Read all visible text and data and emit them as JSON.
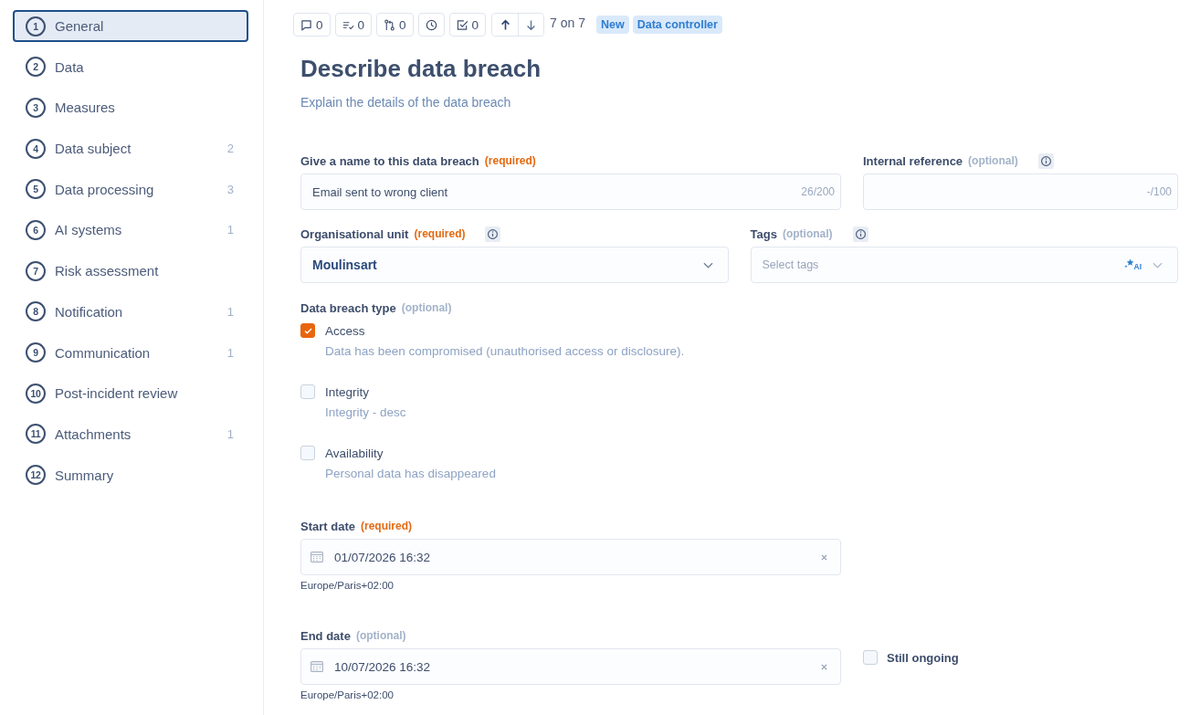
{
  "sidebar": {
    "items": [
      {
        "number": "1",
        "label": "General",
        "selected": true
      },
      {
        "number": "2",
        "label": "Data",
        "selected": false
      },
      {
        "number": "3",
        "label": "Measures",
        "selected": false
      },
      {
        "number": "4",
        "label": "Data subject",
        "count": "2",
        "selected": false
      },
      {
        "number": "5",
        "label": "Data processing",
        "count": "3",
        "selected": false
      },
      {
        "number": "6",
        "label": "AI systems",
        "count": "1",
        "selected": false
      },
      {
        "number": "7",
        "label": "Risk assessment",
        "selected": false
      },
      {
        "number": "8",
        "label": "Notification",
        "count": "1",
        "selected": false
      },
      {
        "number": "9",
        "label": "Communication",
        "count": "1",
        "selected": false
      },
      {
        "number": "10",
        "label": "Post-incident review",
        "selected": false
      },
      {
        "number": "11",
        "label": "Attachments",
        "count": "1",
        "selected": false
      },
      {
        "number": "12",
        "label": "Summary",
        "selected": false
      }
    ]
  },
  "toolbar": {
    "buttons": [
      {
        "kind": "comments",
        "count": "0"
      },
      {
        "kind": "tasks",
        "count": "0"
      },
      {
        "kind": "changes",
        "count": "0"
      },
      {
        "kind": "history"
      },
      {
        "kind": "checks",
        "count": "0"
      }
    ],
    "navigation": [
      {
        "kind": "up"
      },
      {
        "kind": "down"
      }
    ],
    "position": "7 on 7",
    "badges": [
      {
        "label": "New"
      },
      {
        "label": "Data controller"
      }
    ]
  },
  "header": {
    "title": "Describe data breach",
    "subtitle": "Explain the details of the data breach"
  },
  "form": {
    "rows": [
      [
        {
          "kind": "text",
          "label": "Give a name to this data breach",
          "tag": "(required)",
          "required": true,
          "value": "Email sent to wrong client",
          "counter": "26/200"
        },
        {
          "kind": "text",
          "label": "Internal reference",
          "tag": "(optional)",
          "required": false,
          "info": true,
          "counter": "-/100"
        }
      ],
      [
        {
          "kind": "select",
          "label": "Organisational unit",
          "tag": "(required)",
          "required": true,
          "info": true,
          "value": "Moulinsart"
        },
        {
          "kind": "tags",
          "label": "Tags",
          "tag": "(optional)",
          "required": false,
          "info": true,
          "placeholder": "Select tags",
          "ai_label": "AI"
        }
      ]
    ],
    "breach_type": {
      "label": "Data breach type",
      "tag": "(optional)",
      "required": false,
      "options": [
        {
          "label": "Access",
          "description": "Data has been compromised (unauthorised access or disclosure).",
          "checked": true
        },
        {
          "label": "Integrity",
          "description": "Integrity - desc",
          "checked": false
        },
        {
          "label": "Availability",
          "description": "Personal data has disappeared",
          "checked": false
        }
      ]
    },
    "start_date": {
      "label": "Start date",
      "tag": "(required)",
      "required": true,
      "value": "01/07/2026 16:32",
      "timezone": "Europe/Paris+02:00"
    },
    "end_date": {
      "label": "End date",
      "tag": "(optional)",
      "required": false,
      "value": "10/07/2026 16:32",
      "timezone": "Europe/Paris+02:00",
      "ongoing": {
        "label": "Still ongoing",
        "checked": false
      }
    }
  }
}
